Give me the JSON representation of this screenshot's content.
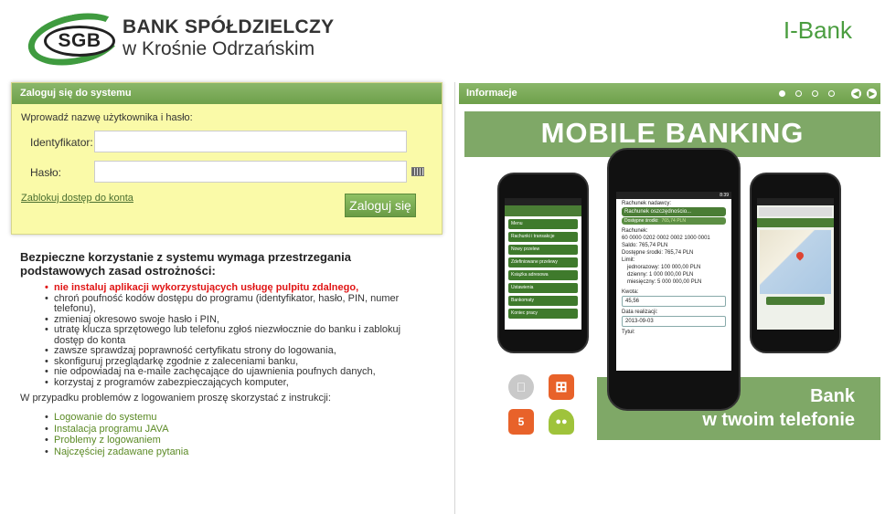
{
  "header": {
    "logo_badge": "SGB",
    "bank_name": "BANK SPÓŁDZIELCZY",
    "bank_location": "w Krośnie Odrzańskim",
    "app_name": "I-Bank",
    "brand_color": "#4a9d3f"
  },
  "login": {
    "title": "Zaloguj się do systemu",
    "prompt": "Wprowadź nazwę użytkownika i hasło:",
    "id_label": "Identyfikator:",
    "id_value": "",
    "password_label": "Hasło:",
    "password_value": "",
    "keyboard_icon": "virtual-keyboard-icon",
    "block_link": "Zablokuj dostęp do konta",
    "submit_label": "Zaloguj się"
  },
  "safety": {
    "title": "Bezpieczne korzystanie z systemu wymaga przestrzegania podstawowych zasad ostrożności:",
    "rules": [
      "nie instaluj aplikacji wykorzystujących usługę pulpitu zdalnego,",
      "chroń poufność kodów dostępu do programu (identyfikator, hasło, PIN, numer telefonu),",
      "zmieniaj okresowo swoje hasło i PIN,",
      "utratę klucza sprzętowego lub telefonu zgłoś niezwłocznie do banku i zablokuj dostęp do konta",
      "zawsze sprawdzaj poprawność certyfikatu strony do logowania,",
      "skonfiguruj przeglądarkę zgodnie z zaleceniami banku,",
      "nie odpowiadaj na e-maile zachęcające do ujawnienia poufnych danych,",
      "korzystaj z programów zabezpieczających komputer,"
    ],
    "warning_color": "#e01515",
    "help_intro": "W przypadku problemów z logowaniem proszę skorzystać z instrukcji:",
    "help_links": [
      "Logowanie do systemu",
      "Instalacja programu JAVA",
      "Problemy z logowaniem",
      "Najczęściej zadawane pytania"
    ]
  },
  "info": {
    "title": "Informacje",
    "slides_total": 4,
    "active_slide": 1,
    "banner_title": "MOBILE BANKING",
    "promo_line1": "Bank",
    "promo_line2": "w twoim telefonie",
    "banner_color": "#7fa867",
    "center_phone": {
      "account_header": "Rachunek nadawcy:",
      "account_select": "Rachunek oszczędnościo...",
      "available_label": "Dostępne środki:",
      "available_value": "765,74 PLN",
      "account_label": "Rachunek:",
      "account_number": "60 0000 0202 0002 0002 1000 0001",
      "balance": "Saldo: 765,74 PLN",
      "available": "Dostępne środki: 765,74 PLN",
      "limit_label": "Limit:",
      "limit_single": "jednorazowy: 100 000,00 PLN",
      "limit_daily": "dzienny: 1 000 000,00 PLN",
      "limit_monthly": "miesięczny: 5 000 000,00 PLN",
      "amount_label": "Kwota:",
      "amount_value": "45,56",
      "date_label": "Data realizacji:",
      "date_value": "2013-09-03",
      "title_label": "Tytuł:",
      "time": "8:39"
    },
    "left_phone": {
      "menu_items": [
        "Menu",
        "Rachunki i transakcje",
        "Nowy przelew",
        "Zdefiniowane przelewy",
        "Książka adresowa",
        "Ustawienia",
        "Bankomaty",
        "Koniec pracy"
      ]
    },
    "os_icons": [
      "apple-icon",
      "windows-icon",
      "html5-icon",
      "android-icon"
    ]
  }
}
